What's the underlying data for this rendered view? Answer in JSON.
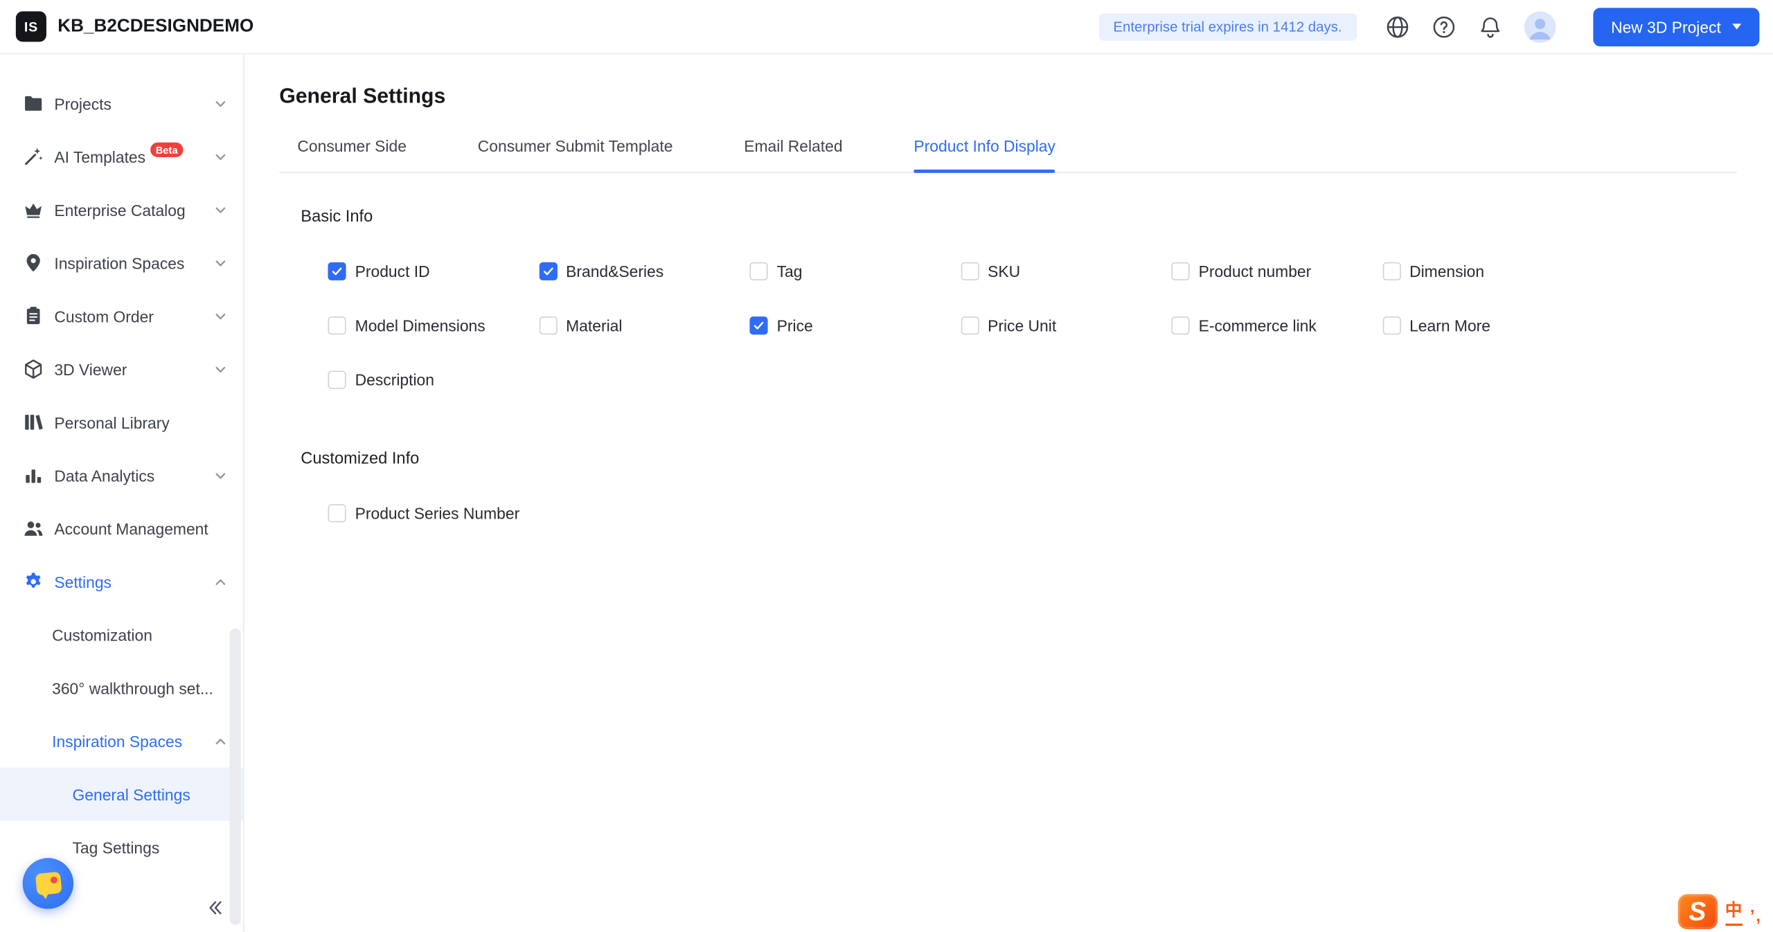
{
  "colors": {
    "accent": "#2e6cf6",
    "badge_bg": "#e9f1fe",
    "badge_text": "#4b7bf0",
    "beta_badge": "#f0403c",
    "selected_row_bg": "#eef3fc"
  },
  "header": {
    "logo_text": "IS",
    "app_title": "KB_B2CDESIGNDEMO",
    "trial_badge": "Enterprise trial expires in 1412 days.",
    "new_project_label": "New 3D Project",
    "icons": [
      "globe-icon",
      "help-icon",
      "bell-icon",
      "avatar"
    ]
  },
  "sidebar": {
    "items": [
      {
        "label": "Projects",
        "icon": "folder",
        "chevron": "down",
        "level": 1
      },
      {
        "label": "AI Templates",
        "icon": "wand",
        "badge": "Beta",
        "chevron": "down",
        "level": 1
      },
      {
        "label": "Enterprise Catalog",
        "icon": "crown",
        "chevron": "down",
        "level": 1
      },
      {
        "label": "Inspiration Spaces",
        "icon": "pin",
        "chevron": "down",
        "level": 1
      },
      {
        "label": "Custom Order",
        "icon": "clipboard",
        "chevron": "down",
        "level": 1
      },
      {
        "label": "3D Viewer",
        "icon": "cube",
        "chevron": "down",
        "level": 1
      },
      {
        "label": "Personal Library",
        "icon": "library",
        "level": 1
      },
      {
        "label": "Data Analytics",
        "icon": "bar-chart",
        "chevron": "down",
        "level": 1
      },
      {
        "label": "Account Management",
        "icon": "users",
        "level": 1
      },
      {
        "label": "Settings",
        "icon": "gear",
        "chevron": "up",
        "level": 1,
        "active": true
      },
      {
        "label": "Customization",
        "level": 2
      },
      {
        "label": "360° walkthrough set...",
        "level": 2
      },
      {
        "label": "Inspiration Spaces",
        "chevron": "up",
        "level": 2,
        "active": true
      },
      {
        "label": "General Settings",
        "level": 3,
        "selected": true
      },
      {
        "label": "Tag Settings",
        "level": 3
      }
    ]
  },
  "main": {
    "page_title": "General Settings",
    "tabs": [
      {
        "label": "Consumer Side",
        "active": false
      },
      {
        "label": "Consumer Submit Template",
        "active": false
      },
      {
        "label": "Email Related",
        "active": false
      },
      {
        "label": "Product Info Display",
        "active": true
      }
    ],
    "sections": [
      {
        "title": "Basic Info",
        "options": [
          {
            "label": "Product ID",
            "checked": true
          },
          {
            "label": "Brand&Series",
            "checked": true
          },
          {
            "label": "Tag",
            "checked": false
          },
          {
            "label": "SKU",
            "checked": false
          },
          {
            "label": "Product number",
            "checked": false
          },
          {
            "label": "Dimension",
            "checked": false
          },
          {
            "label": "Model Dimensions",
            "checked": false
          },
          {
            "label": "Material",
            "checked": false
          },
          {
            "label": "Price",
            "checked": true
          },
          {
            "label": "Price Unit",
            "checked": false
          },
          {
            "label": "E-commerce link",
            "checked": false
          },
          {
            "label": "Learn More",
            "checked": false
          },
          {
            "label": "Description",
            "checked": false
          }
        ]
      },
      {
        "title": "Customized Info",
        "options": [
          {
            "label": "Product Series Number",
            "checked": false
          }
        ]
      }
    ]
  },
  "watermark": {
    "s": "S",
    "zh": "中",
    "marks": "’,"
  }
}
